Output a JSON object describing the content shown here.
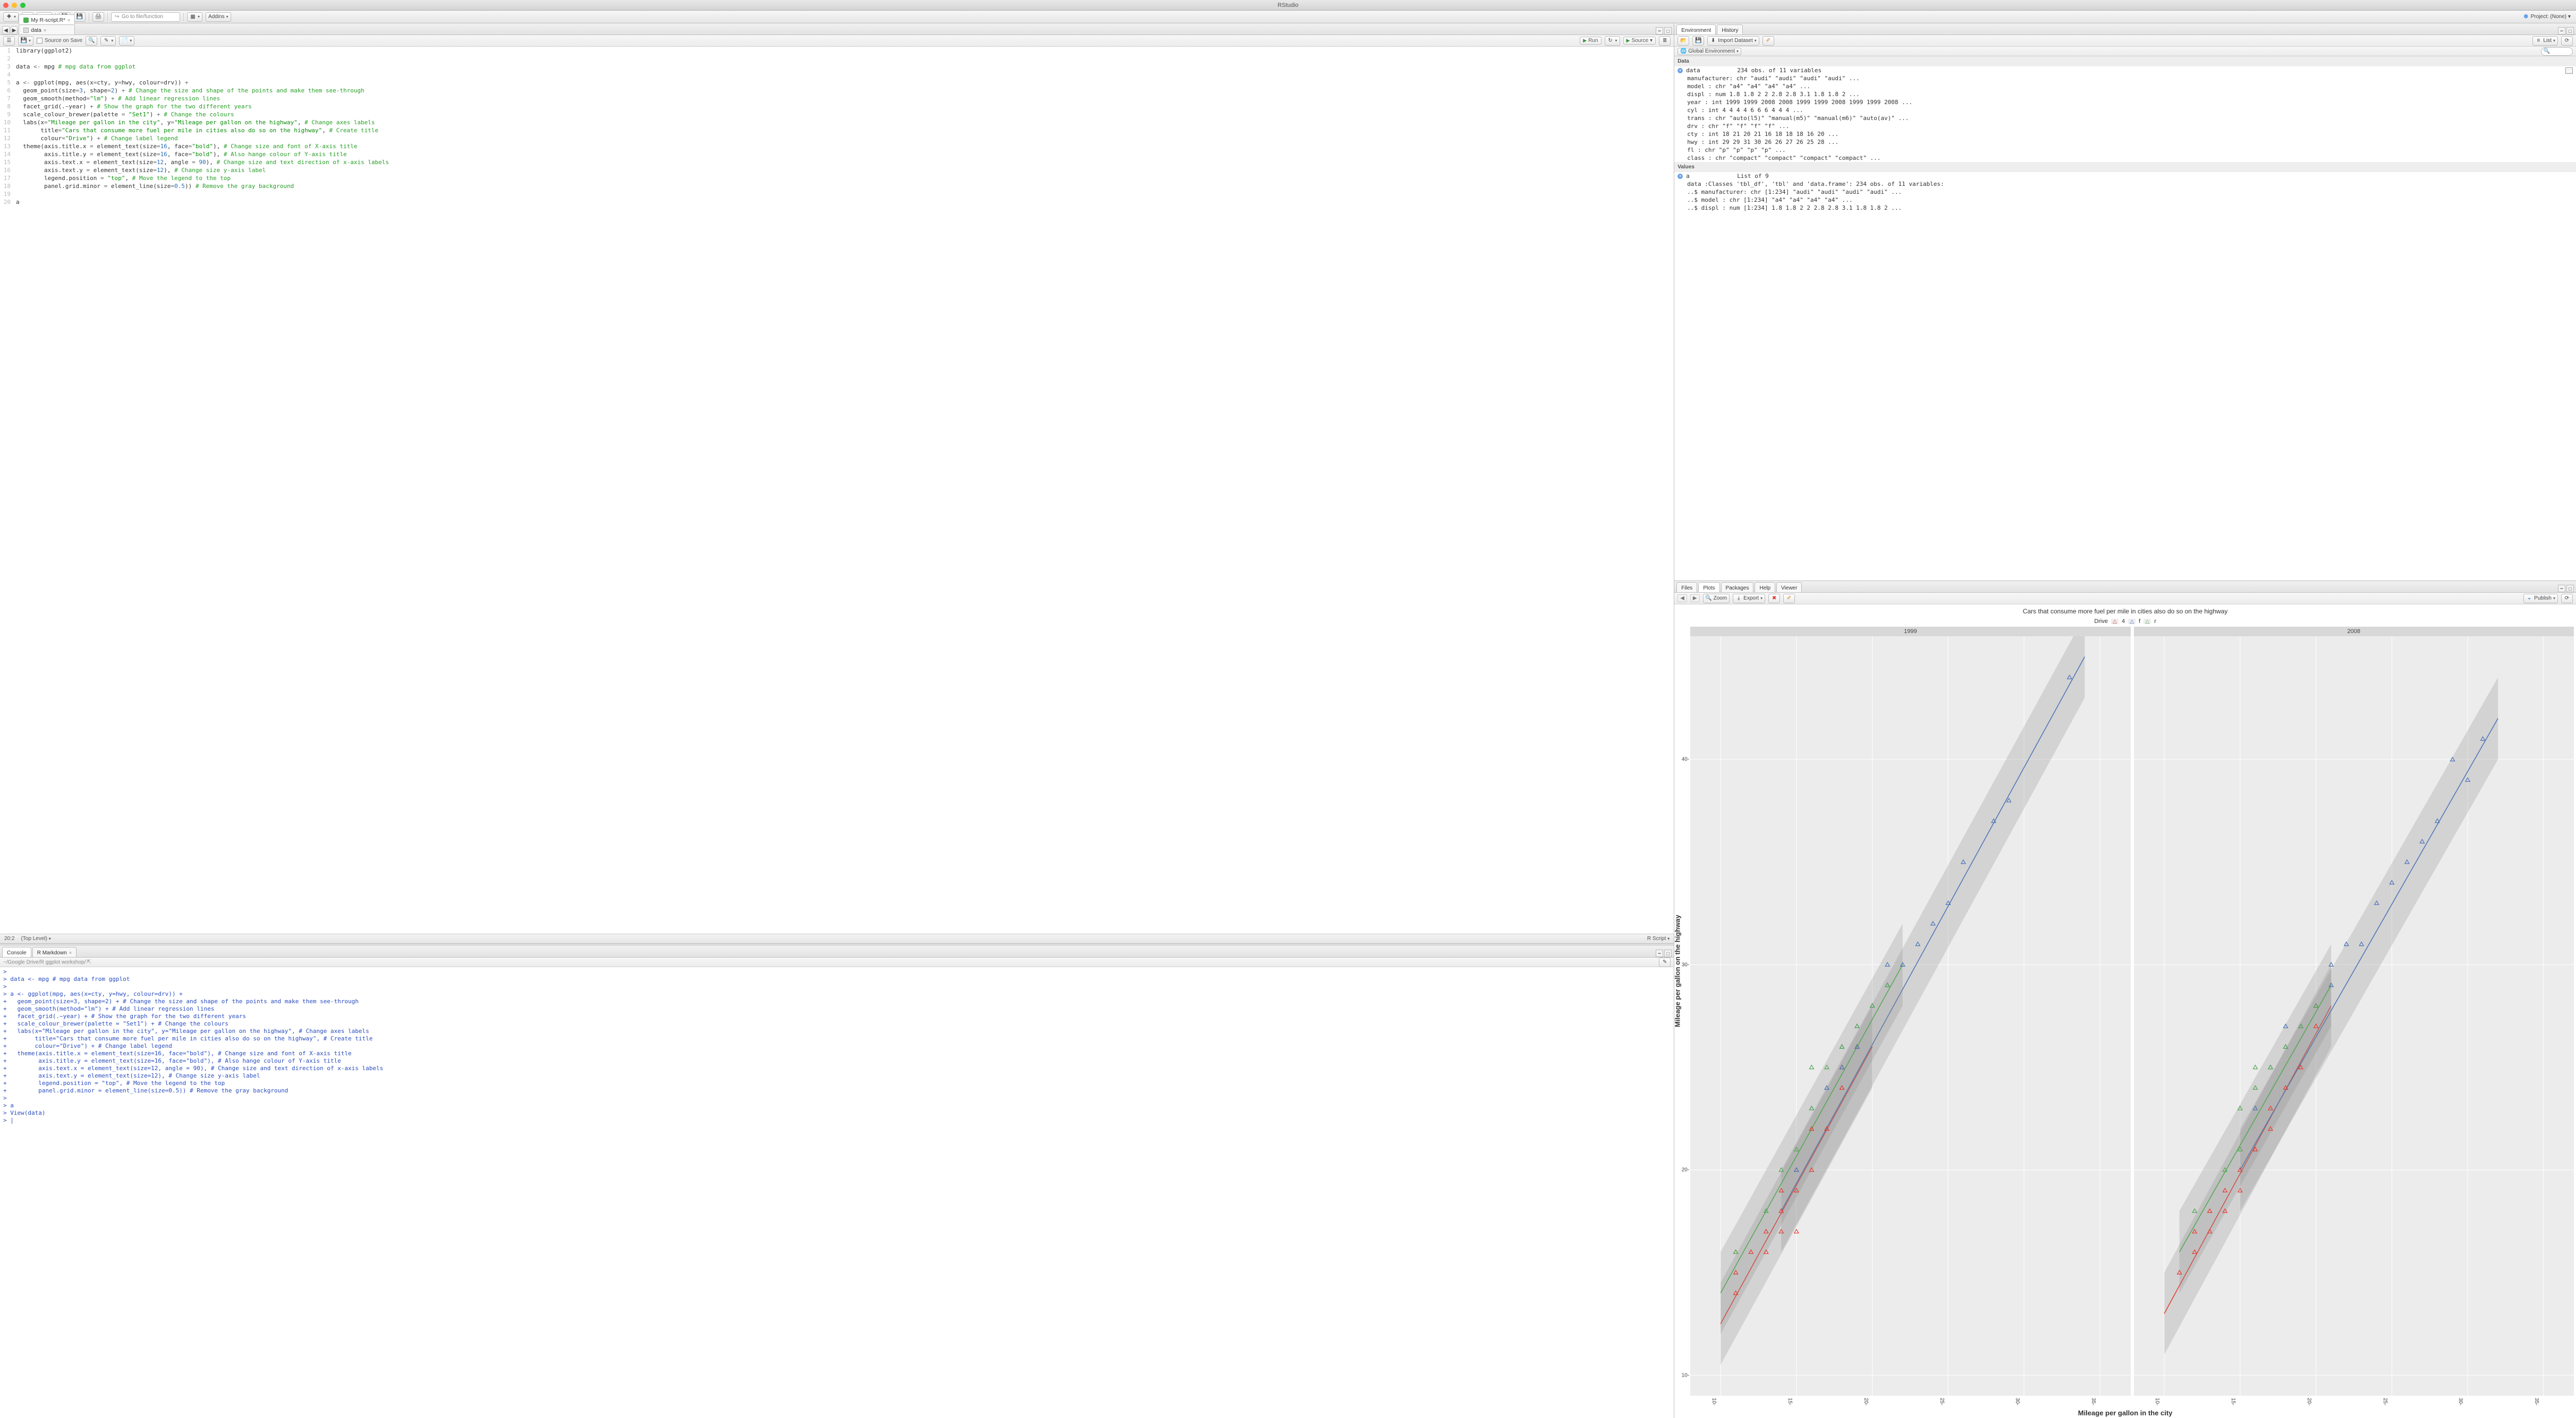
{
  "window_title": "RStudio",
  "project_label": "Project: (None)",
  "goto_placeholder": "Go to file/function",
  "addins_label": "Addins",
  "source_pane": {
    "tabs": [
      {
        "label": "My R-script.R*",
        "kind": "r"
      },
      {
        "label": "data",
        "kind": "d"
      }
    ],
    "toolbar": {
      "source_on_save": "Source on Save",
      "run_label": "Run",
      "source_label": "Source"
    },
    "code_lines": [
      {
        "n": 1,
        "html": "<span class='t-fn'>library</span>(ggplot2)"
      },
      {
        "n": 2,
        "html": ""
      },
      {
        "n": 3,
        "html": "data <span class='t-op'>&lt;-</span> mpg <span class='t-cmt'># mpg data from ggplot</span>"
      },
      {
        "n": 4,
        "html": ""
      },
      {
        "n": 5,
        "html": "a <span class='t-op'>&lt;-</span> <span class='t-fn'>ggplot</span>(mpg, <span class='t-fn'>aes</span>(x<span class='t-op'>=</span>cty, y<span class='t-op'>=</span>hwy, colour<span class='t-op'>=</span>drv)) <span class='t-op'>+</span>"
      },
      {
        "n": 6,
        "html": "  <span class='t-fn'>geom_point</span>(size<span class='t-op'>=</span><span class='t-num'>3</span>, shape<span class='t-op'>=</span><span class='t-num'>2</span>) <span class='t-op'>+</span> <span class='t-cmt'># Change the size and shape of the points and make them see-through</span>"
      },
      {
        "n": 7,
        "html": "  <span class='t-fn'>geom_smooth</span>(method<span class='t-op'>=</span><span class='t-str'>\"lm\"</span>) <span class='t-op'>+</span> <span class='t-cmt'># Add linear regression lines</span>"
      },
      {
        "n": 8,
        "html": "  <span class='t-fn'>facet_grid</span>(.<span class='t-op'>~</span>year) <span class='t-op'>+</span> <span class='t-cmt'># Show the graph for the two different years</span>"
      },
      {
        "n": 9,
        "html": "  <span class='t-fn'>scale_colour_brewer</span>(palette <span class='t-op'>=</span> <span class='t-str'>\"Set1\"</span>) <span class='t-op'>+</span> <span class='t-cmt'># Change the colours</span>"
      },
      {
        "n": 10,
        "html": "  <span class='t-fn'>labs</span>(x<span class='t-op'>=</span><span class='t-str'>\"Mileage per gallon in the city\"</span>, y<span class='t-op'>=</span><span class='t-str'>\"Mileage per gallon on the highway\"</span>, <span class='t-cmt'># Change axes labels</span>"
      },
      {
        "n": 11,
        "html": "       title<span class='t-op'>=</span><span class='t-str'>\"Cars that consume more fuel per mile in cities also do so on the highway\"</span>, <span class='t-cmt'># Create title</span>"
      },
      {
        "n": 12,
        "html": "       colour<span class='t-op'>=</span><span class='t-str'>\"Drive\"</span>) <span class='t-op'>+</span> <span class='t-cmt'># Change label legend</span>"
      },
      {
        "n": 13,
        "html": "  <span class='t-fn'>theme</span>(axis.title.x <span class='t-op'>=</span> <span class='t-fn'>element_text</span>(size<span class='t-op'>=</span><span class='t-num'>16</span>, face<span class='t-op'>=</span><span class='t-str'>\"bold\"</span>), <span class='t-cmt'># Change size and font of X-axis title</span>"
      },
      {
        "n": 14,
        "html": "        axis.title.y <span class='t-op'>=</span> <span class='t-fn'>element_text</span>(size<span class='t-op'>=</span><span class='t-num'>16</span>, face<span class='t-op'>=</span><span class='t-str'>\"bold\"</span>), <span class='t-cmt'># Also hange colour of Y-axis title</span>"
      },
      {
        "n": 15,
        "html": "        axis.text.x <span class='t-op'>=</span> <span class='t-fn'>element_text</span>(size<span class='t-op'>=</span><span class='t-num'>12</span>, angle <span class='t-op'>=</span> <span class='t-num'>90</span>), <span class='t-cmt'># Change size and text direction of x-axis labels</span>"
      },
      {
        "n": 16,
        "html": "        axis.text.y <span class='t-op'>=</span> <span class='t-fn'>element_text</span>(size<span class='t-op'>=</span><span class='t-num'>12</span>), <span class='t-cmt'># Change size y-axis label</span>"
      },
      {
        "n": 17,
        "html": "        legend.position <span class='t-op'>=</span> <span class='t-str'>\"top\"</span>, <span class='t-cmt'># Move the legend to the top</span>"
      },
      {
        "n": 18,
        "html": "        panel.grid.minor <span class='t-op'>=</span> <span class='t-fn'>element_line</span>(size<span class='t-op'>=</span><span class='t-num'>0.5</span>)) <span class='t-cmt'># Remove the gray background</span>"
      },
      {
        "n": 19,
        "html": ""
      },
      {
        "n": 20,
        "html": "a"
      }
    ],
    "status_left": "20:2",
    "status_mid": "(Top Level)",
    "status_right": "R Script"
  },
  "console_pane": {
    "tabs": [
      "Console",
      "R Markdown"
    ],
    "path": "~/Google Drive/R ggplot workshop/",
    "lines": [
      ">",
      "> data <- mpg # mpg data from ggplot",
      ">",
      "> a <- ggplot(mpg, aes(x=cty, y=hwy, colour=drv)) +",
      "+   geom_point(size=3, shape=2) + # Change the size and shape of the points and make them see-through",
      "+   geom_smooth(method=\"lm\") + # Add linear regression lines",
      "+   facet_grid(.~year) + # Show the graph for the two different years",
      "+   scale_colour_brewer(palette = \"Set1\") + # Change the colours",
      "+   labs(x=\"Mileage per gallon in the city\", y=\"Mileage per gallon on the highway\", # Change axes labels",
      "+        title=\"Cars that consume more fuel per mile in cities also do so on the highway\", # Create title",
      "+        colour=\"Drive\") + # Change label legend",
      "+   theme(axis.title.x = element_text(size=16, face=\"bold\"), # Change size and font of X-axis title",
      "+         axis.title.y = element_text(size=16, face=\"bold\"), # Also hange colour of Y-axis title",
      "+         axis.text.x = element_text(size=12, angle = 90), # Change size and text direction of x-axis labels",
      "+         axis.text.y = element_text(size=12), # Change size y-axis label",
      "+         legend.position = \"top\", # Move the legend to the top",
      "+         panel.grid.minor = element_line(size=0.5)) # Remove the gray background",
      ">",
      "> a",
      "> View(data)",
      "> |"
    ]
  },
  "env_pane": {
    "tabs": [
      "Environment",
      "History"
    ],
    "toolbar": {
      "import_label": "Import Dataset",
      "list_label": "List",
      "scope_label": "Global Environment"
    },
    "sections": {
      "data_label": "Data",
      "values_label": "Values"
    },
    "data_obj": {
      "name": "data",
      "summary": "234 obs. of 11 variables",
      "fields": [
        "manufacturer: chr \"audi\" \"audi\" \"audi\" \"audi\" ...",
        "model : chr \"a4\" \"a4\" \"a4\" \"a4\" ...",
        "displ : num 1.8 1.8 2 2 2.8 2.8 3.1 1.8 1.8 2 ...",
        "year : int 1999 1999 2008 2008 1999 1999 2008 1999 1999 2008 ...",
        "cyl : int 4 4 4 4 6 6 6 4 4 4 ...",
        "trans : chr \"auto(l5)\" \"manual(m5)\" \"manual(m6)\" \"auto(av)\" ...",
        "drv : chr \"f\" \"f\" \"f\" \"f\" ...",
        "cty : int 18 21 20 21 16 18 18 18 16 20 ...",
        "hwy : int 29 29 31 30 26 26 27 26 25 28 ...",
        "fl : chr \"p\" \"p\" \"p\" \"p\" ...",
        "class : chr \"compact\" \"compact\" \"compact\" \"compact\" ..."
      ]
    },
    "values_obj": {
      "name": "a",
      "summary": "List of 9",
      "fields": [
        "data :Classes 'tbl_df', 'tbl' and 'data.frame': 234 obs. of 11 variables:",
        "..$ manufacturer: chr [1:234] \"audi\" \"audi\" \"audi\" \"audi\" ...",
        "..$ model : chr [1:234] \"a4\" \"a4\" \"a4\" \"a4\" ...",
        "..$ displ : num [1:234] 1.8 1.8 2 2 2.8 2.8 3.1 1.8 1.8 2 ..."
      ]
    }
  },
  "plots_pane": {
    "tabs": [
      "Files",
      "Plots",
      "Packages",
      "Help",
      "Viewer"
    ],
    "toolbar": {
      "zoom": "Zoom",
      "export": "Export",
      "publish": "Publish"
    }
  },
  "chart_data": {
    "type": "scatter",
    "title": "Cars that consume more fuel per mile in cities also do so on the highway",
    "xlabel": "Mileage per gallon in the city",
    "ylabel": "Mileage per gallon on the highway",
    "legend_title": "Drive",
    "legend_items": [
      "4",
      "f",
      "r"
    ],
    "facets": [
      "1999",
      "2008"
    ],
    "xlim": [
      8,
      37
    ],
    "ylim": [
      9,
      46
    ],
    "xticks": [
      10,
      15,
      20,
      25,
      30,
      35
    ],
    "yticks": [
      10,
      20,
      30,
      40
    ],
    "colors": {
      "4": "#e8392f",
      "f": "#4a72b8",
      "r": "#50a850"
    },
    "series": {
      "1999": {
        "4": [
          [
            11,
            14
          ],
          [
            11,
            15
          ],
          [
            11,
            16
          ],
          [
            12,
            16
          ],
          [
            13,
            17
          ],
          [
            13,
            16
          ],
          [
            14,
            17
          ],
          [
            14,
            18
          ],
          [
            14,
            19
          ],
          [
            15,
            19
          ],
          [
            15,
            20
          ],
          [
            16,
            20
          ],
          [
            16,
            22
          ],
          [
            17,
            22
          ],
          [
            18,
            24
          ],
          [
            18,
            25
          ],
          [
            19,
            26
          ],
          [
            15,
            17
          ]
        ],
        "f": [
          [
            15,
            20
          ],
          [
            16,
            23
          ],
          [
            17,
            24
          ],
          [
            18,
            26
          ],
          [
            18,
            25
          ],
          [
            19,
            27
          ],
          [
            19,
            26
          ],
          [
            20,
            28
          ],
          [
            21,
            29
          ],
          [
            21,
            30
          ],
          [
            22,
            30
          ],
          [
            23,
            31
          ],
          [
            24,
            32
          ],
          [
            25,
            33
          ],
          [
            26,
            35
          ],
          [
            28,
            37
          ],
          [
            33,
            44
          ],
          [
            29,
            38
          ]
        ],
        "r": [
          [
            11,
            16
          ],
          [
            13,
            18
          ],
          [
            14,
            20
          ],
          [
            15,
            21
          ],
          [
            16,
            23
          ],
          [
            16,
            25
          ],
          [
            17,
            25
          ],
          [
            18,
            26
          ],
          [
            19,
            27
          ],
          [
            20,
            28
          ],
          [
            21,
            29
          ]
        ]
      },
      "2008": {
        "4": [
          [
            11,
            15
          ],
          [
            12,
            16
          ],
          [
            12,
            17
          ],
          [
            13,
            17
          ],
          [
            13,
            18
          ],
          [
            14,
            18
          ],
          [
            14,
            19
          ],
          [
            15,
            19
          ],
          [
            15,
            20
          ],
          [
            16,
            21
          ],
          [
            17,
            22
          ],
          [
            17,
            23
          ],
          [
            18,
            24
          ],
          [
            19,
            25
          ],
          [
            20,
            27
          ],
          [
            20,
            28
          ]
        ],
        "f": [
          [
            16,
            23
          ],
          [
            17,
            25
          ],
          [
            18,
            26
          ],
          [
            18,
            27
          ],
          [
            19,
            27
          ],
          [
            20,
            28
          ],
          [
            21,
            29
          ],
          [
            21,
            30
          ],
          [
            22,
            31
          ],
          [
            23,
            31
          ],
          [
            24,
            33
          ],
          [
            25,
            34
          ],
          [
            26,
            35
          ],
          [
            27,
            36
          ],
          [
            28,
            37
          ],
          [
            29,
            40
          ],
          [
            30,
            39
          ],
          [
            31,
            41
          ]
        ],
        "r": [
          [
            12,
            18
          ],
          [
            14,
            20
          ],
          [
            15,
            21
          ],
          [
            15,
            23
          ],
          [
            16,
            24
          ],
          [
            16,
            25
          ],
          [
            17,
            25
          ],
          [
            18,
            26
          ],
          [
            19,
            27
          ],
          [
            20,
            28
          ]
        ]
      }
    },
    "regression": {
      "1999": {
        "4": [
          [
            10,
            12.5
          ],
          [
            20,
            26
          ]
        ],
        "f": [
          [
            14,
            18
          ],
          [
            34,
            45
          ]
        ],
        "r": [
          [
            10,
            14
          ],
          [
            22,
            30
          ]
        ]
      },
      "2008": {
        "4": [
          [
            10,
            13
          ],
          [
            21,
            28
          ]
        ],
        "f": [
          [
            15,
            20
          ],
          [
            32,
            42
          ]
        ],
        "r": [
          [
            11,
            16
          ],
          [
            21,
            29
          ]
        ]
      }
    }
  }
}
